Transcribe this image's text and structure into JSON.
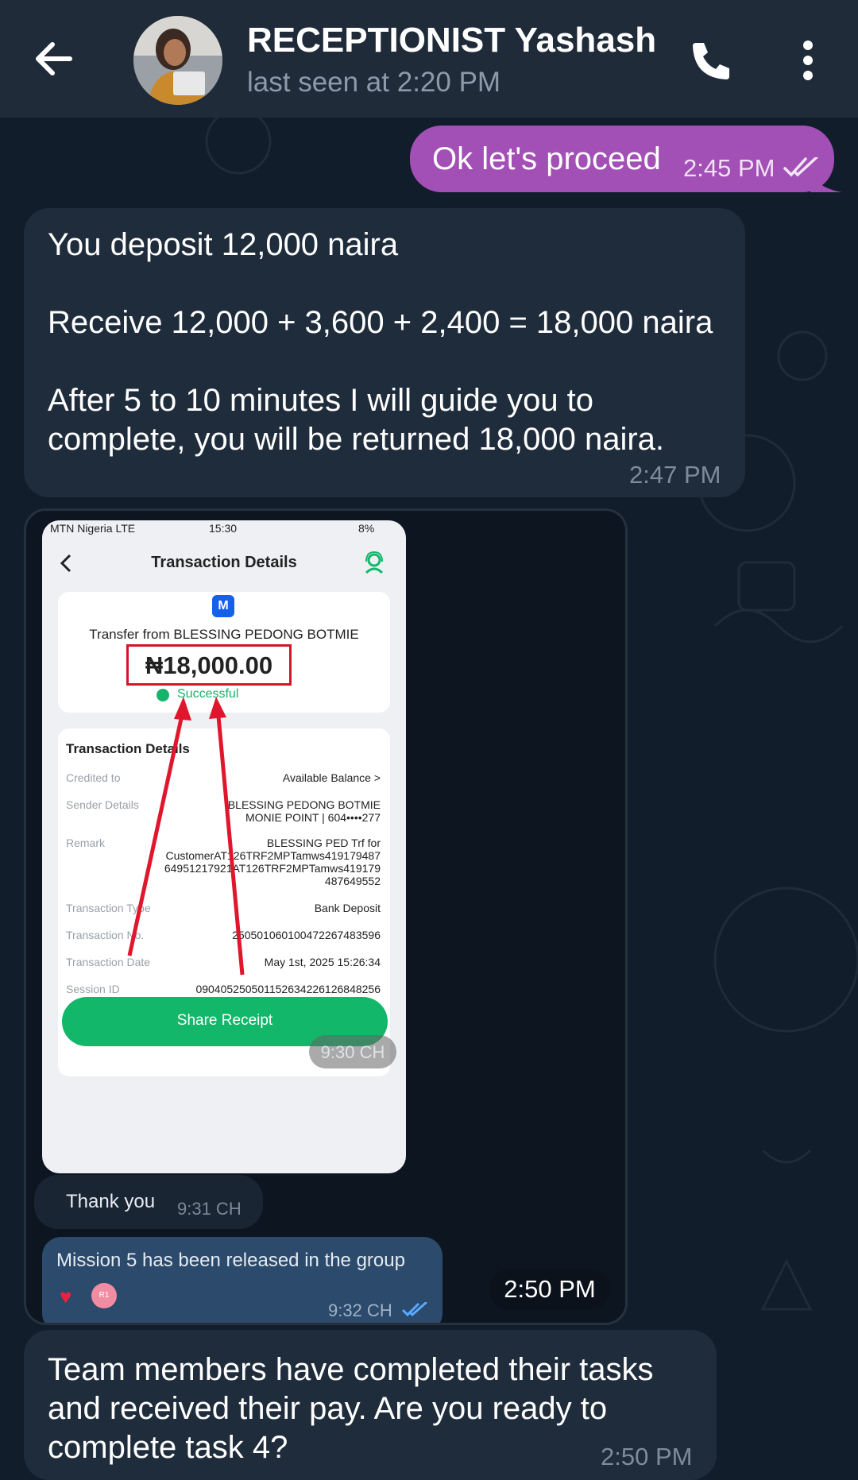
{
  "header": {
    "title": "RECEPTIONIST Yashash",
    "status": "last seen at 2:20 PM",
    "back_icon": "arrow-left-icon",
    "call_icon": "phone-icon",
    "menu_icon": "vertical-dots-icon"
  },
  "messages": {
    "outgoing": {
      "text": "Ok let's proceed",
      "time": "2:45 PM",
      "bubble_color": "#a24fb6"
    },
    "deposit": {
      "line1": "You deposit 12,000 naira",
      "line2": "Receive 12,000 + 3,600 + 2,400 = 18,000 naira",
      "line3a": "After 5 to 10 minutes I will guide you to",
      "line3b": "complete, you will be returned 18,000 naira.",
      "time": "2:47 PM"
    },
    "photo": {
      "time": "2:50 PM"
    },
    "team": {
      "line1": "Team members have completed their tasks",
      "line2": "and received their pay. Are you ready to",
      "line3": "complete task 4?",
      "time": "2:50 PM"
    }
  },
  "receipt": {
    "carrier": "MTN Nigeria  LTE",
    "clock": "15:30",
    "battery": "8%",
    "title": "Transaction Details",
    "logo_letter": "M",
    "transfer_from": "Transfer from BLESSING PEDONG BOTMIE",
    "amount": "₦18,000.00",
    "status": "Successful",
    "section_title": "Transaction Details",
    "rows": [
      {
        "label": "Credited to",
        "value": "Available Balance  >"
      },
      {
        "label": "Sender Details",
        "value": "BLESSING PEDONG BOTMIE",
        "value2": "MONIE POINT | 604••••277"
      },
      {
        "label": "Remark",
        "value": "BLESSING PED Trf for",
        "value2": "CustomerAT126TRF2MPTamws419179487",
        "value3": "64951217921AT126TRF2MPTamws419179",
        "value4": "487649552"
      },
      {
        "label": "Transaction Type",
        "value": "Bank Deposit"
      },
      {
        "label": "Transaction No.",
        "value": "250501060100472267483596"
      },
      {
        "label": "Transaction Date",
        "value": "May 1st, 2025 15:26:34"
      },
      {
        "label": "Session ID",
        "value": "090405250501152634226126848256"
      }
    ],
    "share_label": "Share Receipt",
    "screenshot_time": "9:30 CH",
    "thank_text": "Thank you",
    "thank_time": "9:31 CH",
    "mission_text": "Mission 5 has been released in the group",
    "mission_time": "9:32 CH",
    "reaction_badge": "R1"
  }
}
